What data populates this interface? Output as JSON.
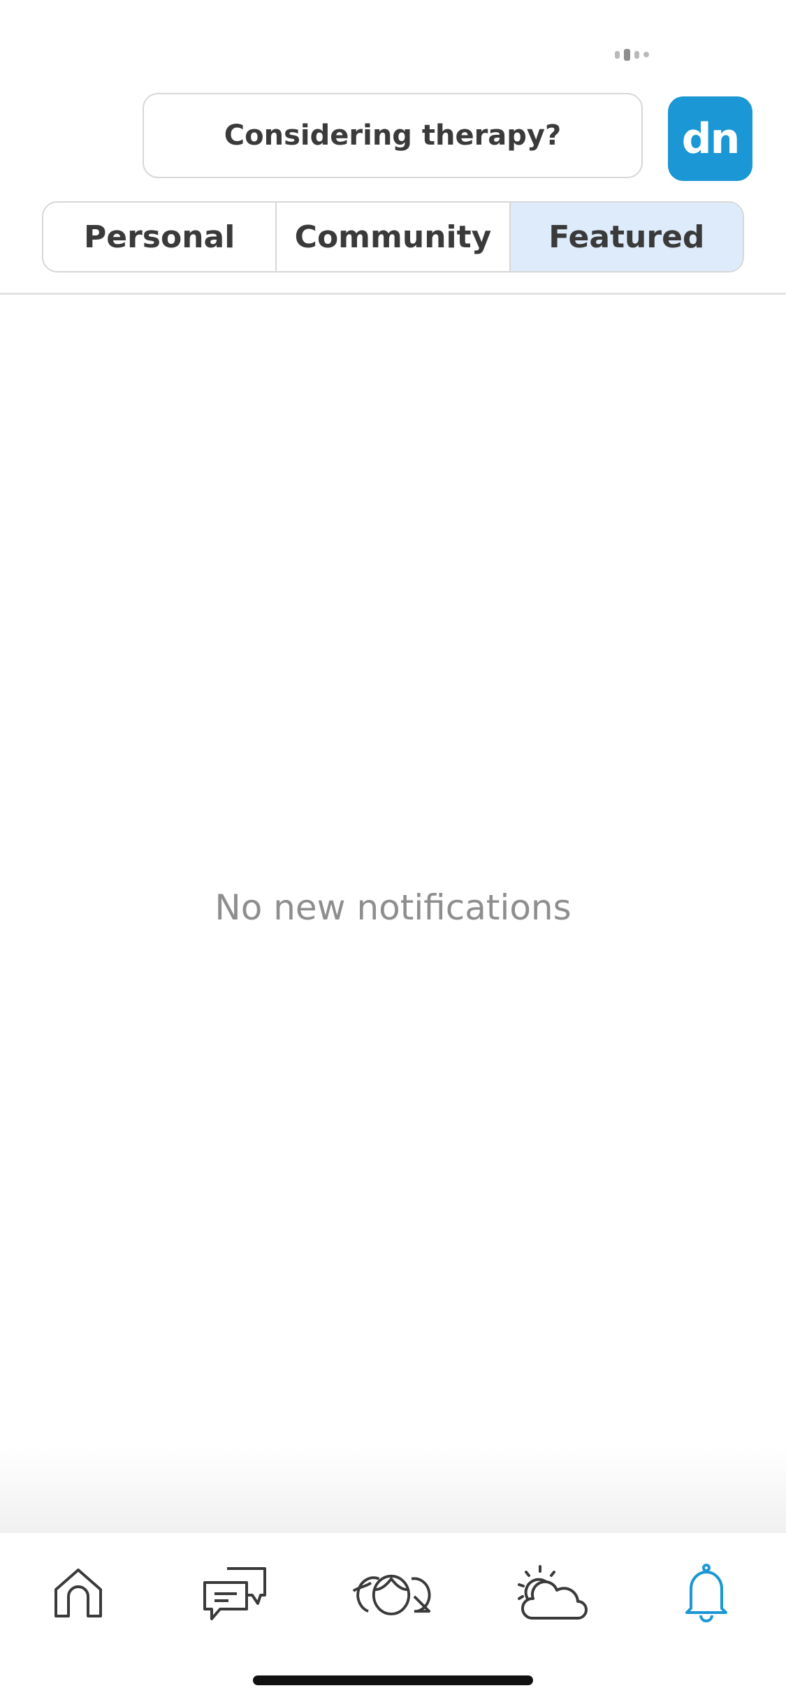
{
  "header": {
    "promo_label": "Considering therapy?",
    "avatar_text": "dn",
    "avatar_color": "#1a97d4"
  },
  "tabs": [
    {
      "label": "Personal",
      "active": false
    },
    {
      "label": "Community",
      "active": false
    },
    {
      "label": "Featured",
      "active": true
    }
  ],
  "empty_state": {
    "message": "No new notifications"
  },
  "bottom_nav": {
    "items": [
      {
        "icon": "home-icon",
        "active": false
      },
      {
        "icon": "chat-bubbles-icon",
        "active": false
      },
      {
        "icon": "community-faces-icon",
        "active": false
      },
      {
        "icon": "weather-sun-cloud-icon",
        "active": false
      },
      {
        "icon": "bell-icon",
        "active": true
      }
    ],
    "active_color": "#1a97d4",
    "inactive_color": "#3a3a3a"
  }
}
